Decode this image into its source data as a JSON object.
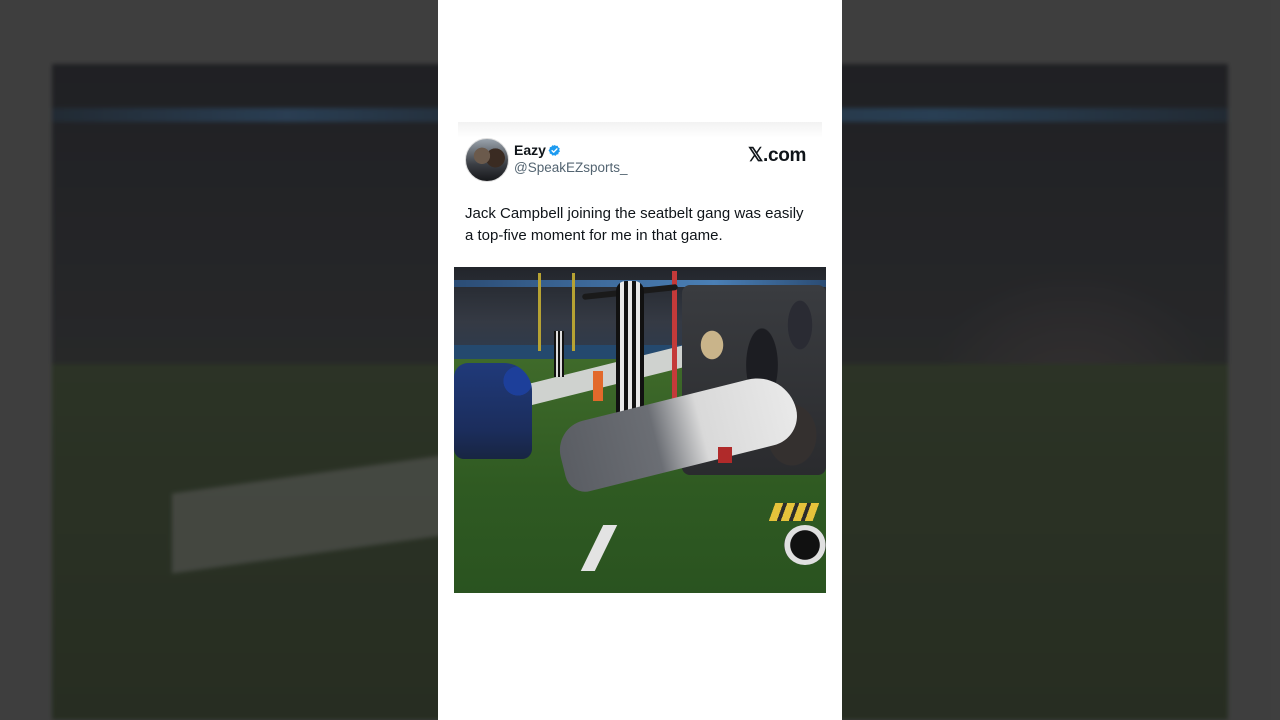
{
  "tweet": {
    "author_name": "Eazy",
    "verified": true,
    "handle": "@SpeakEZsports_",
    "source_label": "𝕏.com",
    "text": "Jack Campbell joining the seatbelt gang was easily a top-five moment for me in that game."
  },
  "colors": {
    "card_background": "#ffffff",
    "verified_badge": "#1d9bf0",
    "backdrop": "#4b4b4b",
    "text_primary": "#0f1419",
    "text_secondary": "#536471"
  },
  "icons": {
    "verified": "verified-badge-icon",
    "avatar": "profile-avatar"
  }
}
